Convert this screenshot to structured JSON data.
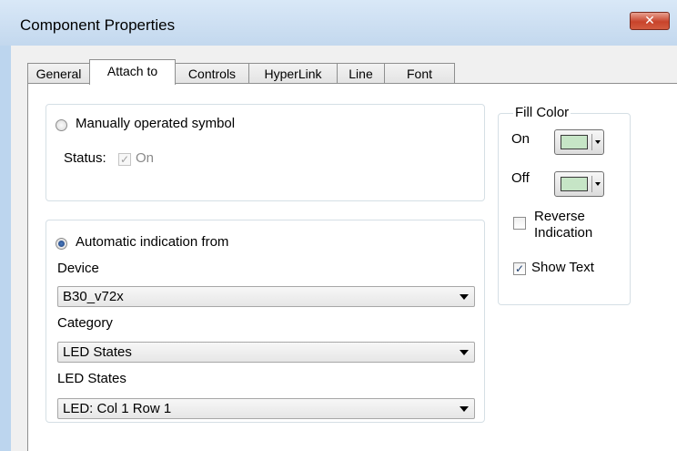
{
  "window": {
    "title": "Component Properties",
    "close_label": "✕"
  },
  "tabs": [
    {
      "label": "General",
      "active": false
    },
    {
      "label": "Attach to",
      "active": true
    },
    {
      "label": "Controls",
      "active": false
    },
    {
      "label": "HyperLink",
      "active": false
    },
    {
      "label": "Line",
      "active": false
    },
    {
      "label": "Font",
      "active": false
    }
  ],
  "manual": {
    "radio_label": "Manually operated symbol",
    "selected": false,
    "status_label": "Status:",
    "on_label": "On",
    "on_checked": true
  },
  "automatic": {
    "radio_label": "Automatic indication from",
    "selected": true,
    "device_label": "Device",
    "device_value": "B30_v72x",
    "category_label": "Category",
    "category_value": "LED States",
    "led_label": "LED States",
    "led_value": "LED: Col 1 Row 1"
  },
  "fill_color": {
    "group_label": "Fill Color",
    "on_label": "On",
    "off_label": "Off",
    "on_color": "#c6e5c6",
    "off_color": "#c6e5c6"
  },
  "options": {
    "reverse_label_line1": "Reverse",
    "reverse_label_line2": "Indication",
    "reverse_checked": false,
    "show_text_label": "Show Text",
    "show_text_checked": true
  },
  "icons": {
    "check": "✓"
  }
}
